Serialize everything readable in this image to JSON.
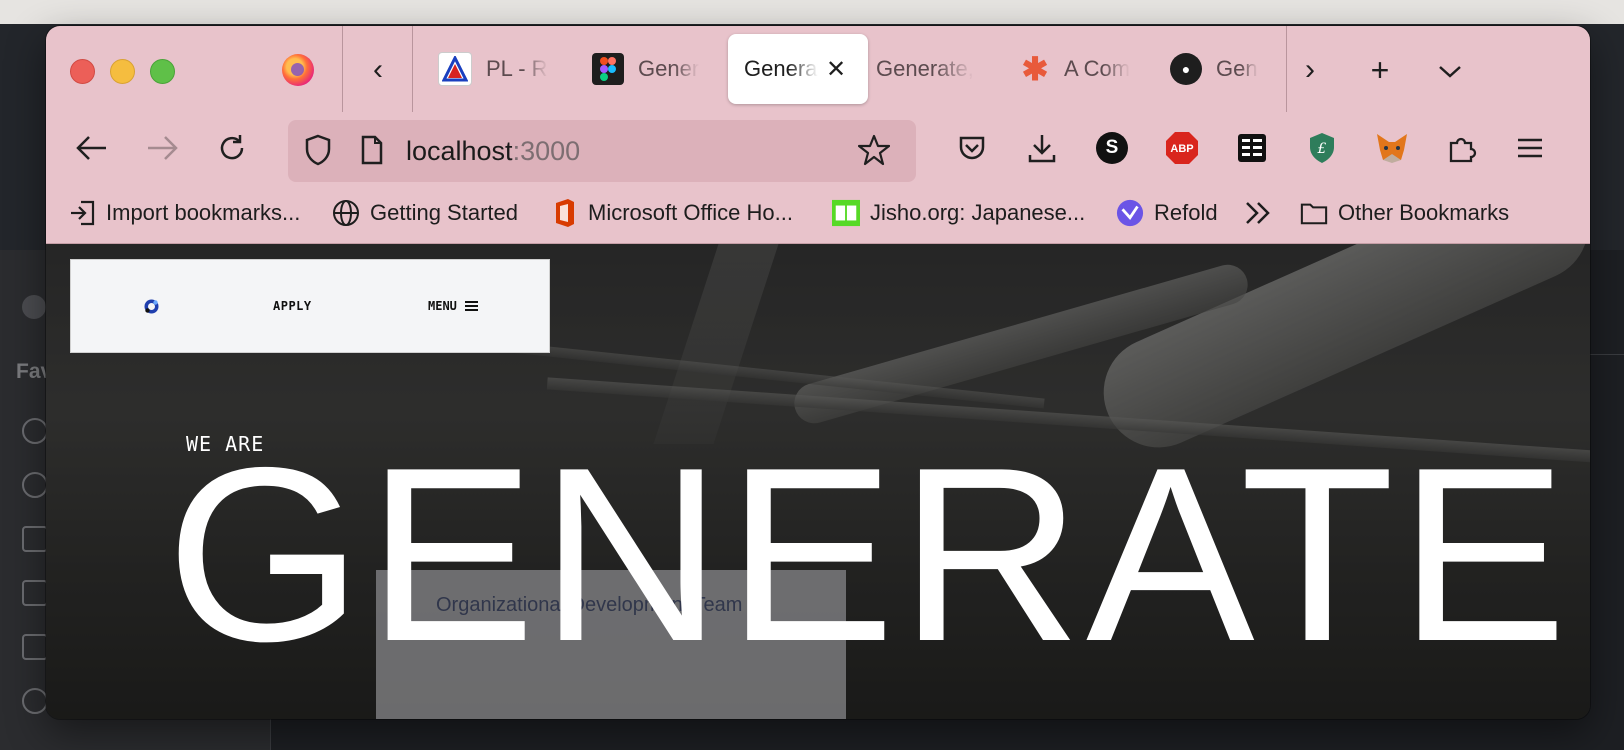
{
  "browser": {
    "tabs": [
      {
        "label": "PL - R",
        "icon": "pl-favicon",
        "active": false
      },
      {
        "label": "Gener",
        "icon": "figma-icon",
        "active": false
      },
      {
        "label": "Generat",
        "icon": "",
        "active": true
      },
      {
        "label": "Generate,",
        "icon": "",
        "active": false
      },
      {
        "label": "A Com",
        "icon": "asterisk-icon",
        "active": false
      },
      {
        "label": "Gen",
        "icon": "github-icon",
        "active": false
      }
    ],
    "url": {
      "host": "localhost",
      "port": ":3000"
    },
    "bookmarks": [
      {
        "label": "Import bookmarks...",
        "icon": "import-icon"
      },
      {
        "label": "Getting Started",
        "icon": "globe-icon"
      },
      {
        "label": "Microsoft Office Ho...",
        "icon": "office-icon"
      },
      {
        "label": "Jisho.org: Japanese...",
        "icon": "jisho-icon"
      },
      {
        "label": "Refold",
        "icon": "refold-icon"
      },
      {
        "label": "Other Bookmarks",
        "icon": "folder-icon"
      }
    ],
    "extensions": {
      "s_label": "S",
      "abp_label": "ABP"
    },
    "accent_color": "#e8c3cb"
  },
  "site": {
    "nav": {
      "apply": "APPLY",
      "menu": "MENU"
    },
    "hero": {
      "subtitle": "WE ARE",
      "title": "GENERATE"
    },
    "banner_text": "Organizational Development Team"
  },
  "desktop": {
    "sidebar_heading": "Fav"
  }
}
